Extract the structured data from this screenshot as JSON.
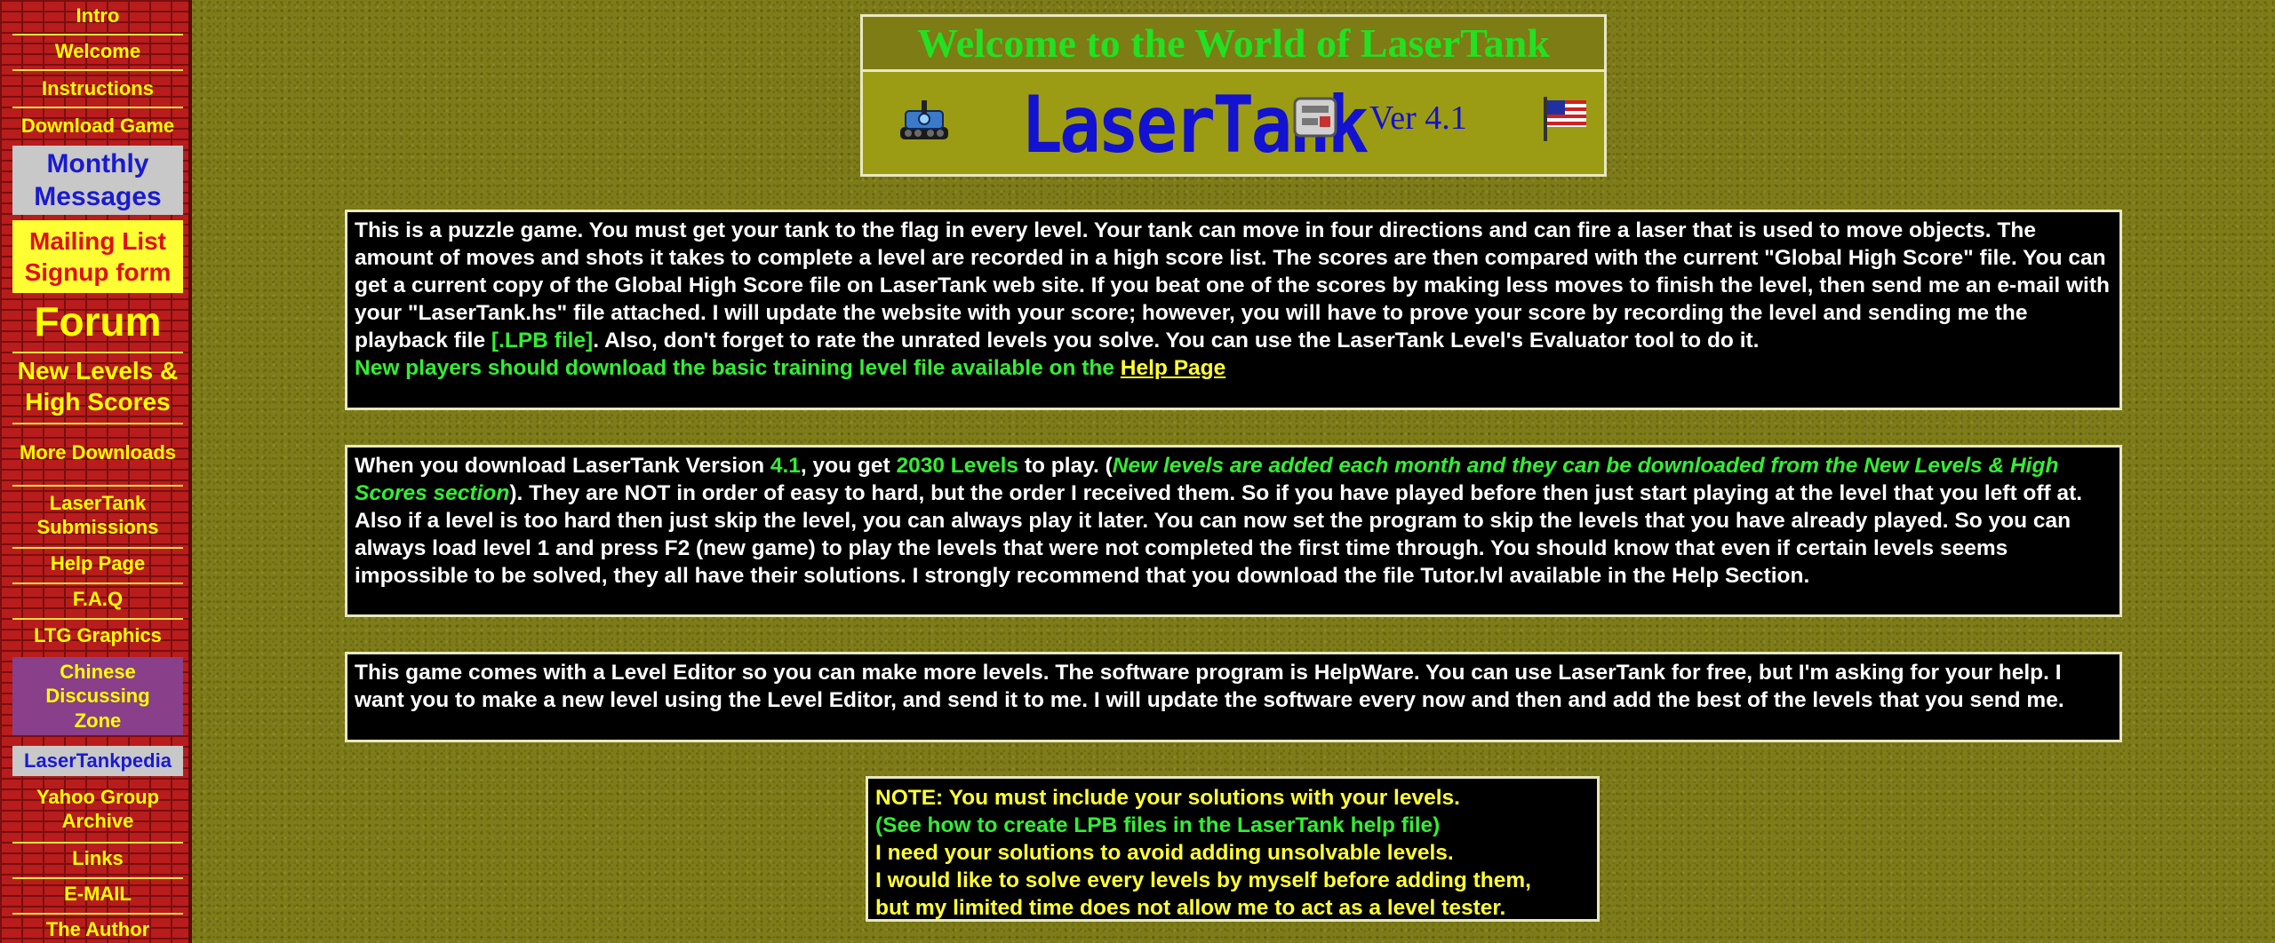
{
  "sidebar": {
    "items": [
      {
        "label": "Intro"
      },
      {
        "label": "Welcome"
      },
      {
        "label": "Instructions"
      },
      {
        "label": "Download Game"
      },
      {
        "label": "Monthly Messages"
      },
      {
        "label": "Mailing List Signup form"
      },
      {
        "label": "Forum"
      },
      {
        "label": "New Levels & High Scores"
      },
      {
        "label": "More Downloads"
      },
      {
        "label": "LaserTank Submissions"
      },
      {
        "label": "Help Page"
      },
      {
        "label": "F.A.Q"
      },
      {
        "label": "LTG Graphics"
      },
      {
        "label": "Chinese Discussing Zone"
      },
      {
        "label": "LaserTankpedia"
      },
      {
        "label": "Yahoo Group Archive"
      },
      {
        "label": "Links"
      },
      {
        "label": "E-MAIL"
      },
      {
        "label": "The Author"
      }
    ]
  },
  "header": {
    "title": "Welcome to the World of LaserTank",
    "logo_text": "LaserTank",
    "version": "Ver 4.1"
  },
  "panels": {
    "intro": {
      "text_1": "This is a puzzle game. You must get your tank to the flag in every level. Your tank can move in four directions and can fire a laser that is used to move objects. The amount of moves and shots it takes to complete a level are recorded in a high score list. The scores are then compared with the current \"Global High Score\" file. You can get a current copy of the Global High Score file on LaserTank web site. If you beat one of the scores by making less moves to finish the level, then send me an e-mail with your \"LaserTank.hs\" file attached. I will update the website with your score; however, you will have to prove your score by recording the level and sending me the playback file ",
      "lpb": "[.LPB file]",
      "text_2": ". Also, don't forget to rate the unrated levels you solve. You can use the LaserTank Level's Evaluator tool to do it.",
      "new_players": "New players should download the basic training level file available on the ",
      "help_link": "Help Page"
    },
    "version": {
      "text_1": "When you download LaserTank Version ",
      "version": "4.1",
      "text_2": ", you get ",
      "levels": "2030 Levels",
      "text_3": " to play. (",
      "italic": "New levels are added each month and they can be downloaded from the New Levels & High Scores section",
      "text_4": "). They are NOT in order of easy to hard, but the order I received them. So if you have played before then just start playing at the level that you left off at. Also if a level is too hard then just skip the level, you can always play it later. You can now set the program to skip the levels that you have already played. So you can always load level 1 and press F2 (new game) to play the levels that were not completed the first time through. You should know that even if certain levels seems impossible to be solved, they all have their solutions. I strongly recommend that you download the file Tutor.lvl available in the Help Section."
    },
    "editor": {
      "text": "This game comes with a Level Editor so you can make more levels. The software program is HelpWare. You can use LaserTank for free, but I'm asking for your help. I want you to make a new level using the Level Editor, and send it to me. I will update the software every now and then and add the best of the levels that you send me."
    }
  },
  "note": {
    "line_1": "NOTE: You must include your solutions with your levels.",
    "line_2": "(See how to create LPB files in the LaserTank help file)",
    "line_3": "I need your solutions to avoid adding unsolvable levels.",
    "line_4": "I would like to solve every levels by myself before adding them,",
    "line_5": "but my limited time does not allow me to act as a level tester."
  },
  "colors": {
    "background": "#7e7c18",
    "sidebar": "#b81c1c",
    "nav_text": "#ffff00",
    "panel": "#000000",
    "highlight_green": "#33ee33"
  },
  "icons": [
    "tank-icon",
    "chip-icon",
    "flag-icon"
  ]
}
